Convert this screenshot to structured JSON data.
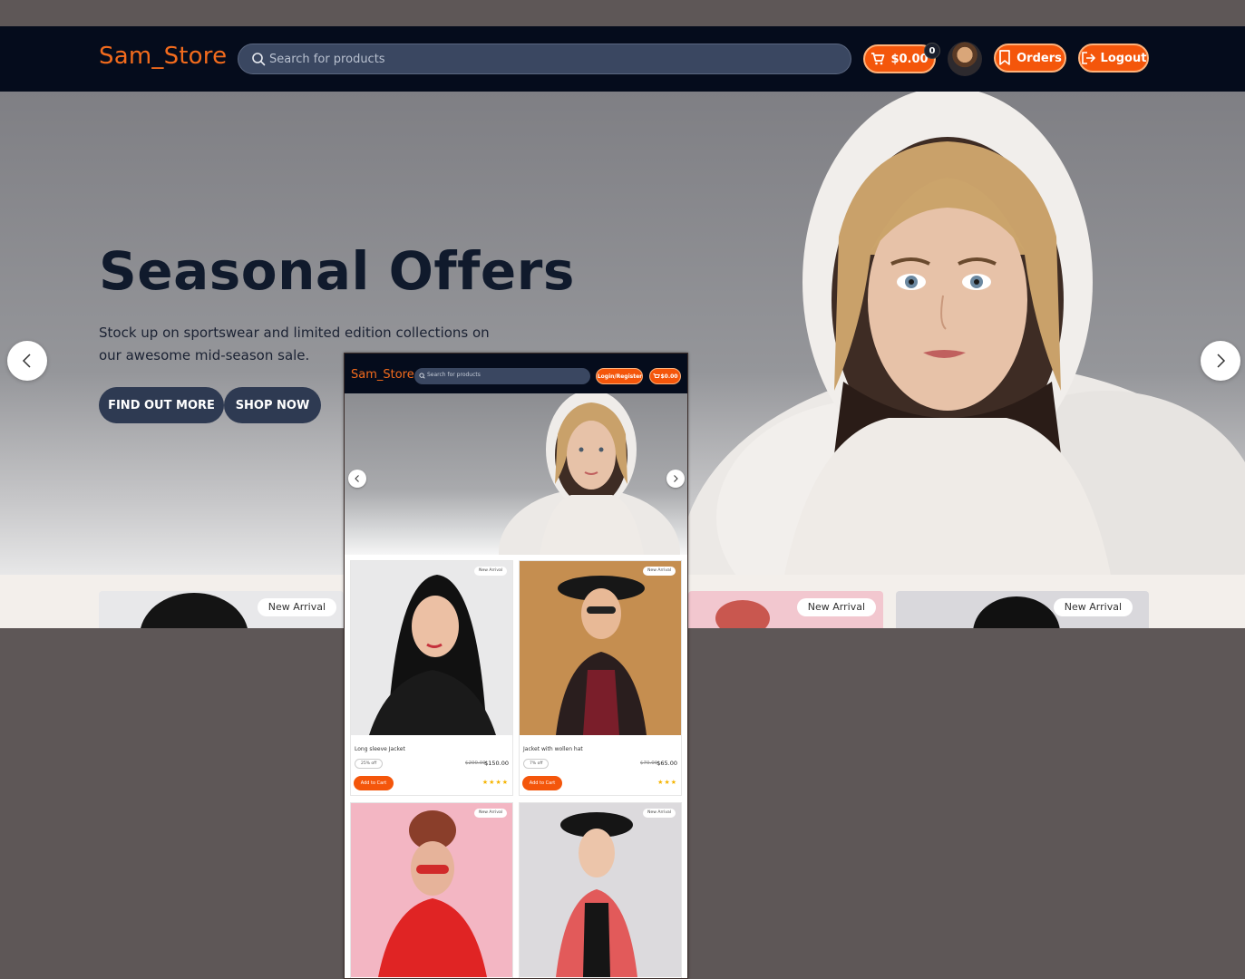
{
  "header": {
    "logo": "Sam_Store",
    "search_placeholder": "Search for products",
    "cart_total": "$0.00",
    "cart_count": "0",
    "orders_label": "Orders",
    "logout_label": "Logout"
  },
  "hero": {
    "title": "Seasonal Offers",
    "subtitle": "Stock up on sportswear and limited edition collections on our awesome mid-season sale.",
    "find_out_more": "FIND OUT MORE",
    "shop_now": "SHOP NOW"
  },
  "product_strip": {
    "tags": [
      "New Arrival",
      "New Arrival",
      "New Arrival"
    ]
  },
  "mobile": {
    "logo": "Sam_Store",
    "search_placeholder": "Search for products",
    "login_label": "Login/Register",
    "cart_total": "$0.00",
    "products": [
      {
        "tag": "New Arrival",
        "name": "Long sleeve Jacket",
        "discount": "25% off",
        "old_price": "$200.00",
        "price": "$150.00",
        "stars": "★★★★",
        "cta": "Add to Cart"
      },
      {
        "tag": "New Arrival",
        "name": "Jacket with wollen hat",
        "discount": "7% off",
        "old_price": "$70.00",
        "price": "$65.00",
        "stars": "★★★",
        "cta": "Add to Cart"
      },
      {
        "tag": "New Arrival"
      },
      {
        "tag": "New Arrival"
      }
    ]
  },
  "colors": {
    "brand": "#f26b1d",
    "nav_bg": "#050c1c",
    "button_orange": "#f4560b",
    "hero_button": "#2e3a52"
  },
  "icons": [
    "search-icon",
    "cart-icon",
    "bookmark-icon",
    "logout-icon",
    "chevron-left-icon",
    "chevron-right-icon",
    "user-icon"
  ]
}
